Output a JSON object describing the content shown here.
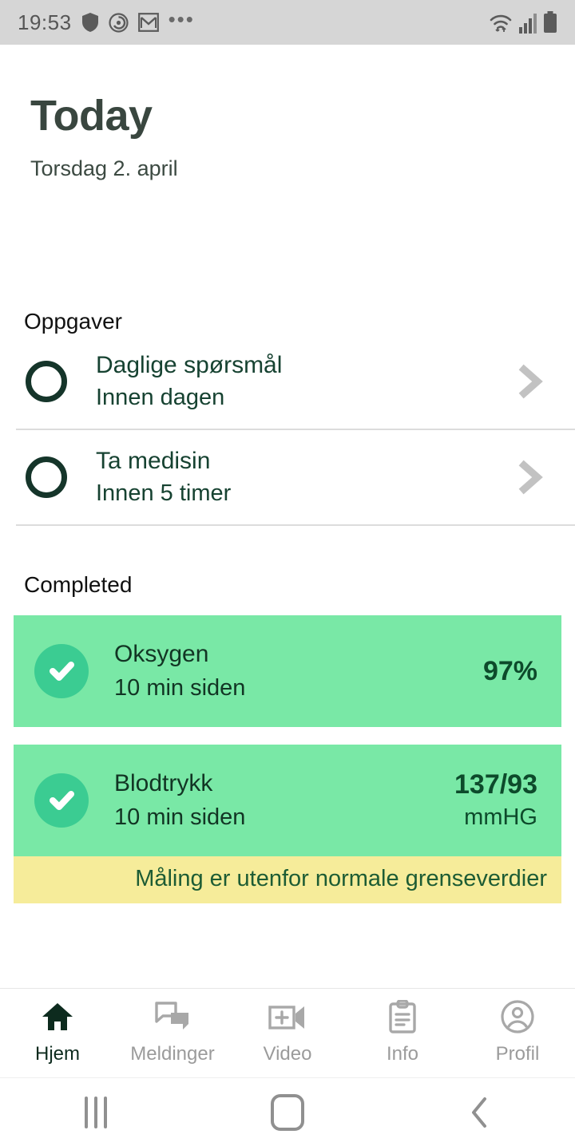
{
  "statusbar": {
    "time": "19:53",
    "left_icons": [
      "shield-icon",
      "target-icon",
      "gmail-icon",
      "overflow-dots-icon"
    ],
    "overflow": "•••",
    "right_icons": [
      "wifi-icon",
      "cellular-signal-icon",
      "battery-icon"
    ],
    "bg_color": "#d6d6d6"
  },
  "header": {
    "title": "Today",
    "date": "Torsdag 2. april",
    "title_color": "#39463f"
  },
  "tasks": {
    "section_title": "Oppgaver",
    "items": [
      {
        "title": "Daglige spørsmål",
        "subtitle": "Innen dagen",
        "status_icon": "empty-circle-icon",
        "chevron": "chevron-right-icon"
      },
      {
        "title": "Ta medisin",
        "subtitle": "Innen 5 timer",
        "status_icon": "empty-circle-icon",
        "chevron": "chevron-right-icon"
      }
    ]
  },
  "completed": {
    "section_title": "Completed",
    "card_color": "#79e8a6",
    "check_color": "#3bcc92",
    "warning_color": "#f6ec9a",
    "items": [
      {
        "title": "Oksygen",
        "subtitle": "10 min siden",
        "value": "97%",
        "unit": "",
        "status_icon": "check-circle-icon",
        "warning": ""
      },
      {
        "title": "Blodtrykk",
        "subtitle": "10 min siden",
        "value": "137/93",
        "unit": "mmHG",
        "status_icon": "check-circle-icon",
        "warning": "Måling er utenfor normale grenseverdier"
      }
    ]
  },
  "tabbar": {
    "items": [
      {
        "label": "Hjem",
        "icon": "home-icon",
        "active": true
      },
      {
        "label": "Meldinger",
        "icon": "chat-bubbles-icon",
        "active": false
      },
      {
        "label": "Video",
        "icon": "video-call-icon",
        "active": false
      },
      {
        "label": "Info",
        "icon": "clipboard-icon",
        "active": false
      },
      {
        "label": "Profil",
        "icon": "account-circle-icon",
        "active": false
      }
    ],
    "active_color": "#0d2b1e",
    "inactive_color": "#9b9b9b"
  },
  "navbar": {
    "buttons": [
      "recents-icon",
      "home-square-icon",
      "back-chevron-icon"
    ]
  }
}
